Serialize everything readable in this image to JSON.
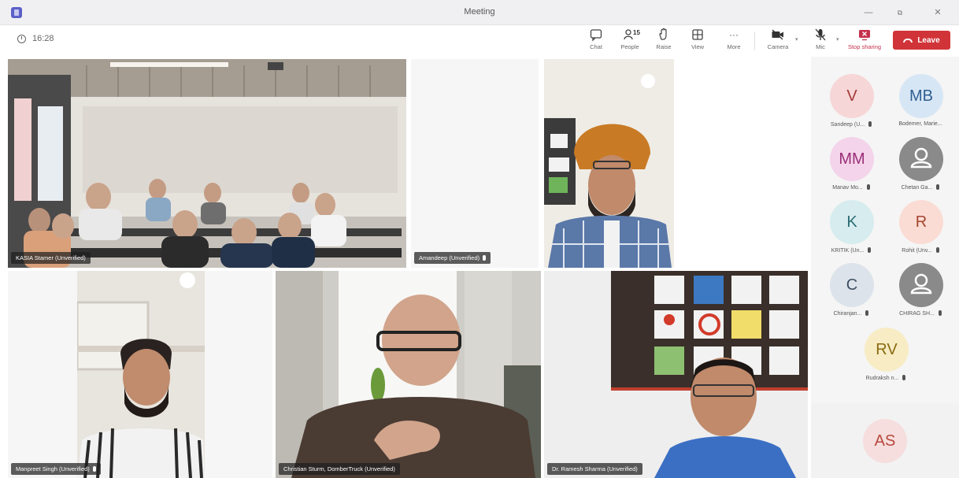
{
  "window": {
    "title": "Meeting",
    "minimize": "—",
    "restore": "⧉",
    "close": "✕"
  },
  "toolbar": {
    "timer": "16:28",
    "chat_label": "Chat",
    "people_label": "People",
    "people_count": "15",
    "raise_label": "Raise",
    "view_label": "View",
    "more_label": "More",
    "camera_label": "Camera",
    "mic_label": "Mic",
    "share_label": "Stop sharing",
    "leave_label": "Leave"
  },
  "icons": {
    "chat": "chat-icon",
    "people": "people-icon",
    "raise": "hand-icon",
    "view": "grid-icon",
    "more": "ellipsis-icon",
    "camera": "camera-icon",
    "mic": "mic-muted-icon",
    "share": "share-screen-icon",
    "leave": "phone-icon"
  },
  "colors": {
    "accent": "#5b5fc7",
    "leave": "#d13438",
    "share": "#c4314b"
  },
  "tiles": [
    {
      "name": "KASIA Stamer (Unverified)"
    },
    {
      "name": "Amandeep (Unverified)"
    },
    {
      "name": "Manpreet Singh (Unverified)"
    },
    {
      "name": "Christian Sturm, DomberTruck (Unverified)"
    },
    {
      "name": "Dr. Ramesh Sharma (Unverified)"
    }
  ],
  "roster": [
    {
      "initials": "V",
      "name": "Sandeep (U...",
      "bg": "#f6d6d6",
      "fg": "#a33b3b"
    },
    {
      "initials": "MB",
      "name": "Bodemer, Marie...",
      "bg": "#d7e6f5",
      "fg": "#2f5f8f"
    },
    {
      "initials": "MM",
      "name": "Manav Mo...",
      "bg": "#f4d4ea",
      "fg": "#9a2f78"
    },
    {
      "initials": "",
      "name": "Chetan Ga...",
      "bg": "#8a8a8a",
      "fg": "#ffffff"
    },
    {
      "initials": "K",
      "name": "KRITIK (Un...",
      "bg": "#d6ecef",
      "fg": "#2c6b74"
    },
    {
      "initials": "R",
      "name": "Rohit (Unv...",
      "bg": "#fadcd4",
      "fg": "#a4462f"
    },
    {
      "initials": "C",
      "name": "Chiranjan...",
      "bg": "#dde3ea",
      "fg": "#3e4f63"
    },
    {
      "initials": "",
      "name": "CHIRAG SH...",
      "bg": "#8a8a8a",
      "fg": "#ffffff"
    },
    {
      "initials": "RV",
      "name": "Rudraksh n...",
      "bg": "#f7ecc4",
      "fg": "#8a6b10"
    }
  ],
  "bottom_avatar": {
    "initials": "AS",
    "bg": "#f6dede",
    "fg": "#b8473c"
  }
}
